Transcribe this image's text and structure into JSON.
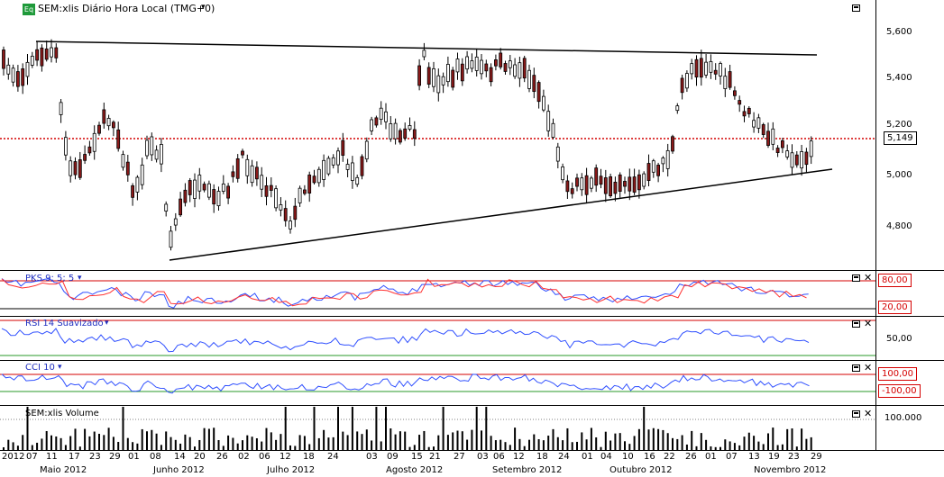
{
  "main": {
    "title": "SEM:xlis Diário Hora Local (TMG+0)",
    "badge": "Eq",
    "current_price": "5,149",
    "y_labels": [
      "5,600",
      "5,400",
      "5,200",
      "5,000",
      "4,800"
    ]
  },
  "pks": {
    "title": "PKS 9; 5; 5",
    "upper": "80,00",
    "lower": "20,00"
  },
  "rsi": {
    "title": "RSI 14 Suavizado",
    "level": "50,00"
  },
  "cci": {
    "title": "CCI 10",
    "upper": "100,00",
    "lower": "-100,00"
  },
  "volume": {
    "title": "SEM:xlis Volume",
    "level": "100.000"
  },
  "x_axis": {
    "days": [
      "2012",
      "07",
      "11",
      "17",
      "23",
      "29",
      "01",
      "08",
      "14",
      "20",
      "26",
      "02",
      "06",
      "12",
      "18",
      "24",
      "03",
      "09",
      "15",
      "21",
      "27",
      "03",
      "06",
      "12",
      "18",
      "24",
      "01",
      "04",
      "10",
      "16",
      "22",
      "26",
      "01",
      "07",
      "13",
      "19",
      "23",
      "29"
    ],
    "months": [
      "Maio 2012",
      "Junho 2012",
      "Julho 2012",
      "Agosto 2012",
      "Setembro 2012",
      "Outubro 2012",
      "Novembro 2012"
    ]
  },
  "colors": {
    "up": "#ffffff",
    "down": "#8b1a1a",
    "pks_k": "#3050ff",
    "pks_d": "#ff3030",
    "level_line": "#d40000",
    "cci_zero": "#2a9a2a",
    "price_line": "#d40000"
  }
}
